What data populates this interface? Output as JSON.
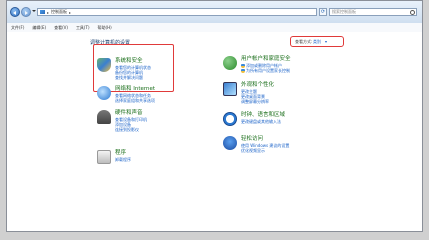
{
  "window": {
    "address_path": "控制面板",
    "search_placeholder": "搜索控制面板",
    "menu": [
      "文件(F)",
      "编辑(E)",
      "查看(V)",
      "工具(T)",
      "帮助(H)"
    ]
  },
  "content": {
    "page_title": "调整计算机的设置",
    "view_by_label": "查看方式:",
    "view_by_value": "类别"
  },
  "left_categories": [
    {
      "icon": "shield-security-icon",
      "title": "系统和安全",
      "links": [
        "查看您的计算机状态",
        "备份您的计算机",
        "查找并解决问题"
      ]
    },
    {
      "icon": "globe-network-icon",
      "title": "网络和 Internet",
      "links": [
        "查看网络状态和任务",
        "选择家庭组和共享选项"
      ]
    },
    {
      "icon": "printer-hardware-icon",
      "title": "硬件和声音",
      "links": [
        "查看设备和打印机",
        "添加设备",
        "连接到投影仪"
      ]
    },
    {
      "icon": "programs-icon",
      "title": "程序",
      "links": [
        "卸载程序"
      ]
    }
  ],
  "right_categories": [
    {
      "icon": "users-icon",
      "title": "用户帐户和家庭安全",
      "links": [
        "添加或删除用户帐户",
        "为所有用户设置家长控制"
      ]
    },
    {
      "icon": "monitor-appearance-icon",
      "title": "外观和个性化",
      "links": [
        "更改主题",
        "更改桌面背景",
        "调整屏幕分辨率"
      ]
    },
    {
      "icon": "clock-globe-icon",
      "title": "时钟、语言和区域",
      "links": [
        "更改键盘或其他输入法"
      ]
    },
    {
      "icon": "accessibility-icon",
      "title": "轻松访问",
      "links": [
        "使用 Windows 建议的设置",
        "优化视频显示"
      ]
    }
  ]
}
